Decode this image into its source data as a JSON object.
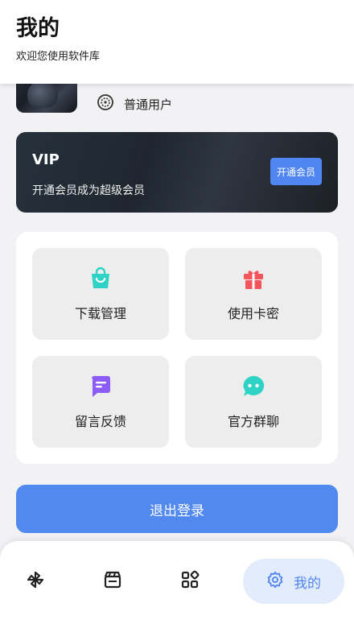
{
  "header": {
    "title": "我的",
    "subtitle": "欢迎您使用软件库"
  },
  "profile": {
    "user_type": "普通用户",
    "user_type_icon": "user-badge-icon"
  },
  "vip": {
    "title": "VIP",
    "description": "开通会员成为超级会员",
    "button_label": "开通会员"
  },
  "menu": {
    "items": [
      {
        "label": "下载管理",
        "icon": "shopping-bag-icon",
        "color": "#2ed3c6"
      },
      {
        "label": "使用卡密",
        "icon": "gift-icon",
        "color": "#f4545b"
      },
      {
        "label": "留言反馈",
        "icon": "message-icon",
        "color": "#8b5cf6"
      },
      {
        "label": "官方群聊",
        "icon": "chat-bubble-icon",
        "color": "#2ed3c6"
      }
    ]
  },
  "logout_label": "退出登录",
  "nav": {
    "items": [
      {
        "icon": "pinwheel-icon"
      },
      {
        "icon": "clapperboard-icon"
      },
      {
        "icon": "apps-icon"
      },
      {
        "icon": "gear-icon",
        "label": "我的",
        "active": true
      }
    ]
  },
  "colors": {
    "accent": "#4f86f2",
    "active_nav_bg": "#e3ecfb"
  }
}
